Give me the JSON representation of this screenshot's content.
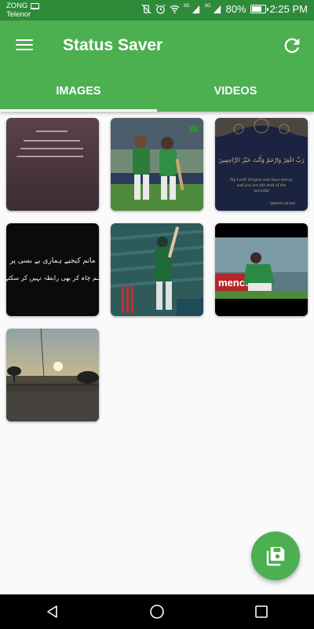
{
  "status_bar": {
    "carrier_top": "ZONG",
    "carrier_bottom": "Telenor",
    "network_1": "3G",
    "network_2": "3G",
    "battery_percent": "80%",
    "battery_level": 0.8,
    "time": "2:25 PM"
  },
  "app_bar": {
    "title": "Status Saver",
    "tabs": [
      {
        "label": "IMAGES",
        "selected": true
      },
      {
        "label": "VIDEOS",
        "selected": false
      }
    ]
  },
  "grid": {
    "items": [
      {
        "kind": "urdu-poetry-dark-pink"
      },
      {
        "kind": "cricket-players-celebrating"
      },
      {
        "kind": "islamic-dua-navy"
      },
      {
        "kind": "urdu-poetry-black"
      },
      {
        "kind": "cricket-batsman-stadium"
      },
      {
        "kind": "cricket-fielder-kneeling"
      },
      {
        "kind": "sunset-landscape"
      }
    ]
  },
  "thumb_text": {
    "dua_arabic": "رَبِّ اغْفِرْ وَارْحَمْ وَأَنْتَ خَيْرُ الرَّاحِمِينَ",
    "dua_english_1": "My Lord! Forgive and have mercy,",
    "dua_english_2": "and you are the best of the",
    "dua_english_3": "merciful",
    "dua_ref": "QURAN 23:118",
    "poetry_line_1": "ماتم کیجیے ہماری بے بسی پر",
    "poetry_line_2": "ہم چاہ کر بھی رابطہ نہیں کر سکتے",
    "stadium_banner": "menom"
  },
  "fab": {
    "icon": "save-all-icon"
  },
  "colors": {
    "status_bar": "#2e8b3a",
    "app_bar": "#4caf50",
    "background": "#fafafa"
  }
}
